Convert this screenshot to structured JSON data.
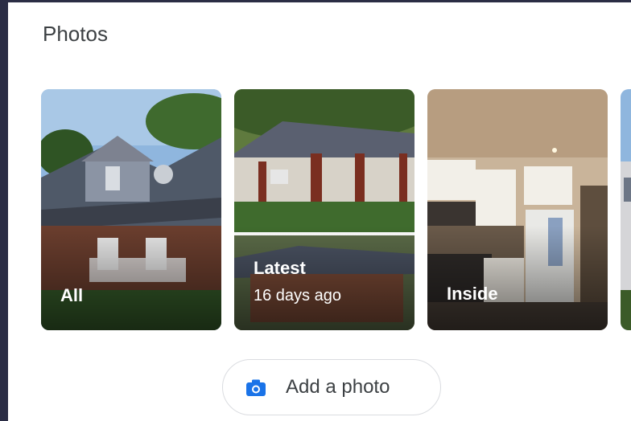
{
  "section": {
    "title": "Photos"
  },
  "cards": [
    {
      "label": "All",
      "sub": ""
    },
    {
      "label": "Latest",
      "sub": "16 days ago"
    },
    {
      "label": "Inside",
      "sub": ""
    }
  ],
  "add_button": {
    "label": "Add a photo",
    "icon": "camera-icon"
  },
  "colors": {
    "accent": "#1a73e8",
    "text": "#3c4043",
    "border": "#dadce0"
  }
}
